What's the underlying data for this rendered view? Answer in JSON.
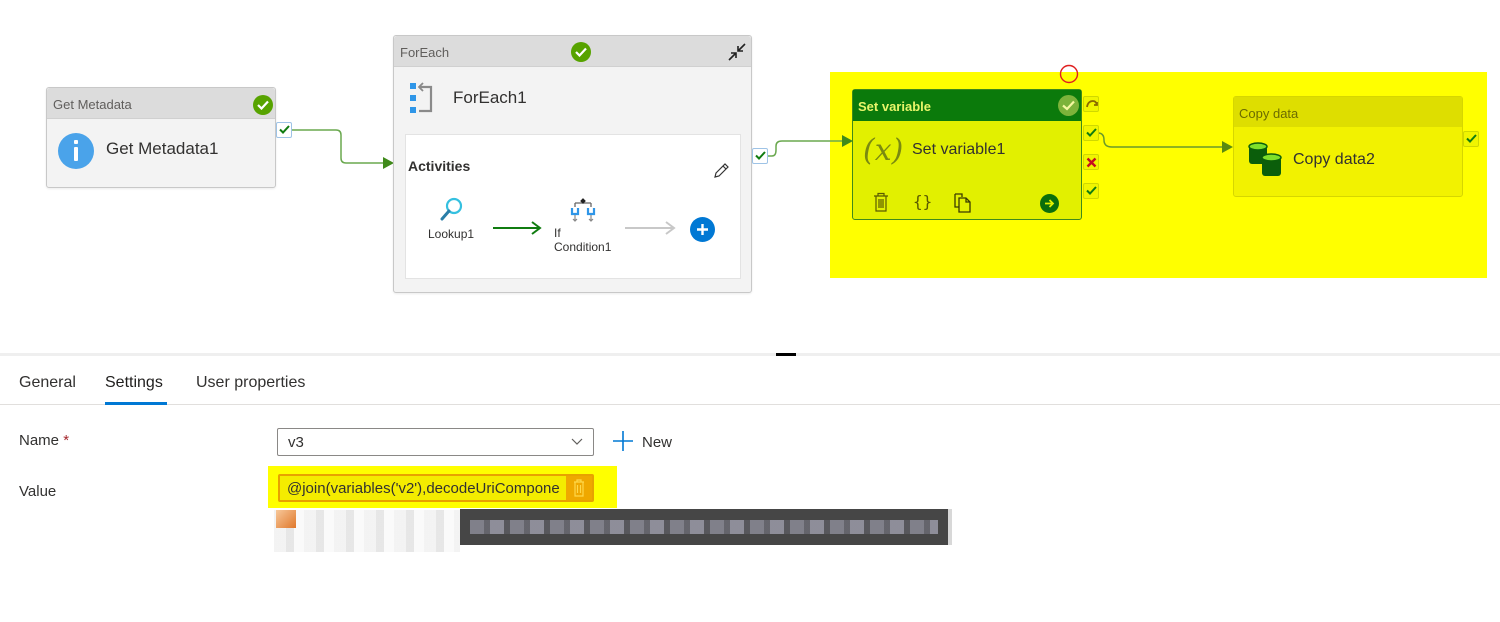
{
  "pipeline": {
    "activities": {
      "get_metadata": {
        "type_label": "Get Metadata",
        "name": "Get Metadata1",
        "status": "succeeded"
      },
      "foreach": {
        "type_label": "ForEach",
        "name": "ForEach1",
        "status": "succeeded",
        "activities_label": "Activities",
        "inner": [
          {
            "name": "Lookup1"
          },
          {
            "name": "If Condition1",
            "line1": "If",
            "line2": "Condition1"
          }
        ]
      },
      "set_variable": {
        "type_label": "Set variable",
        "name": "Set variable1",
        "status": "succeeded",
        "icon_text": "(x)"
      },
      "copy_data": {
        "type_label": "Copy data",
        "name": "Copy data2"
      }
    },
    "colors": {
      "success_green": "#57a300",
      "link_green": "#6aa84f",
      "selected_header": "#0b7a0b",
      "highlight_yellow": "#ffff00",
      "accent_blue": "#0078d4",
      "fail_red": "#c50f1f"
    }
  },
  "panel": {
    "tabs": [
      {
        "label": "General",
        "active": false
      },
      {
        "label": "Settings",
        "active": true
      },
      {
        "label": "User properties",
        "active": false
      }
    ],
    "settings": {
      "name_label": "Name",
      "required_mark": "*",
      "name_value": "v3",
      "new_label": "New",
      "value_label": "Value",
      "value_text": "@join(variables('v2'),decodeUriCompone"
    }
  }
}
